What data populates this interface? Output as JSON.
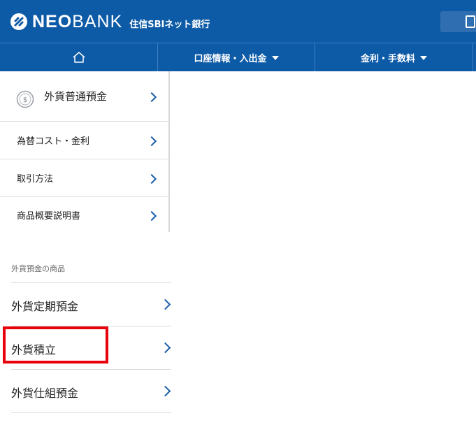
{
  "header": {
    "brand_bold": "NEO",
    "brand_light": "BANK",
    "brand_sub": "住信SBIネット銀行",
    "calculator_icon": "calculator-icon"
  },
  "nav": {
    "home_icon": "home-icon",
    "items": [
      {
        "label": "口座情報・入出金"
      },
      {
        "label": "金利・手数料"
      }
    ]
  },
  "panel": {
    "main": {
      "label": "外貨普通預金",
      "icon": "coin-icon"
    },
    "items": [
      {
        "label": "為替コスト・金利"
      },
      {
        "label": "取引方法"
      },
      {
        "label": "商品概要説明書"
      }
    ]
  },
  "products": {
    "title": "外貨預金の商品",
    "items": [
      {
        "label": "外貨定期預金"
      },
      {
        "label": "外貨積立"
      },
      {
        "label": "外貨仕組預金"
      }
    ]
  },
  "colors": {
    "header_bg": "#0d5aa7",
    "chevron": "#1a5ea8",
    "highlight": "#e8000b"
  }
}
